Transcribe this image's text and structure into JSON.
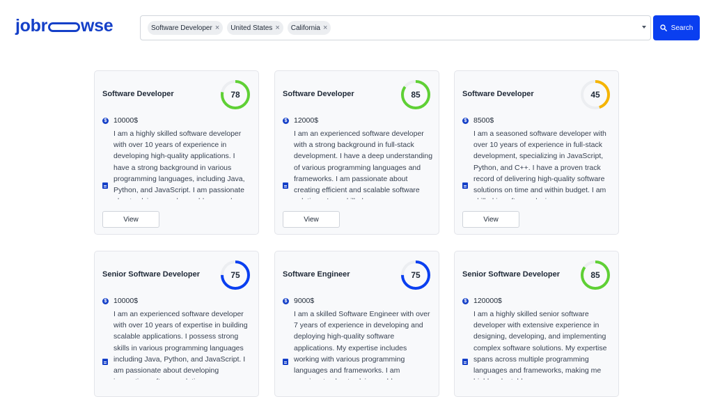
{
  "app": {
    "logo_left": "jobr",
    "logo_right": "wse"
  },
  "search": {
    "chips": [
      {
        "label": "Software Developer"
      },
      {
        "label": "United States"
      },
      {
        "label": "California"
      }
    ],
    "chip_remove": "×",
    "button_label": "Search"
  },
  "colors": {
    "brand": "#1540c8",
    "search_button": "#0a3ff0",
    "score_green": "#5fd035",
    "score_orange": "#f5b400",
    "score_blue": "#0a3ff0",
    "ring_track": "#eceef1"
  },
  "cards": [
    {
      "title": "Software Developer",
      "score": 78,
      "score_color": "#5fd035",
      "salary": "10000$",
      "description": "I am a highly skilled software developer with over 10 years of experience in developing high-quality applications. I have a strong background in various programming languages, including Java, Python, and JavaScript. I am passionate about solving complex problems and delivering",
      "view_label": "View"
    },
    {
      "title": "Software Developer",
      "score": 85,
      "score_color": "#5fd035",
      "salary": "12000$",
      "description": "I am an experienced software developer with a strong background in full-stack development. I have a deep understanding of various programming languages and frameworks. I am passionate about creating efficient and scalable software solutions. I am skilled",
      "view_label": "View"
    },
    {
      "title": "Software Developer",
      "score": 45,
      "score_color": "#f5b400",
      "salary": "8500$",
      "description": "I am a seasoned software developer with over 10 years of experience in full-stack development, specializing in JavaScript, Python, and C++. I have a proven track record of delivering high-quality software solutions on time and within budget. I am skilled in software design",
      "view_label": "View"
    },
    {
      "title": "Senior Software Developer",
      "score": 75,
      "score_color": "#0a3ff0",
      "salary": "10000$",
      "description": "I am an experienced software developer with over 10 years of expertise in building scalable applications. I possess strong skills in various programming languages including Java, Python, and JavaScript. I am passionate about developing innovative software solutions",
      "view_label": "View"
    },
    {
      "title": "Software Engineer",
      "score": 75,
      "score_color": "#0a3ff0",
      "salary": "9000$",
      "description": "I am a skilled Software Engineer with over 7 years of experience in developing and deploying high-quality software applications. My expertise includes working with various programming languages and frameworks. I am passionate about solving problems",
      "view_label": "View"
    },
    {
      "title": "Senior Software Developer",
      "score": 85,
      "score_color": "#5fd035",
      "salary": "120000$",
      "description": "I am a highly skilled senior software developer with extensive experience in designing, developing, and implementing complex software solutions. My expertise spans across multiple programming languages and frameworks, making me highly adaptable",
      "view_label": "View"
    }
  ]
}
